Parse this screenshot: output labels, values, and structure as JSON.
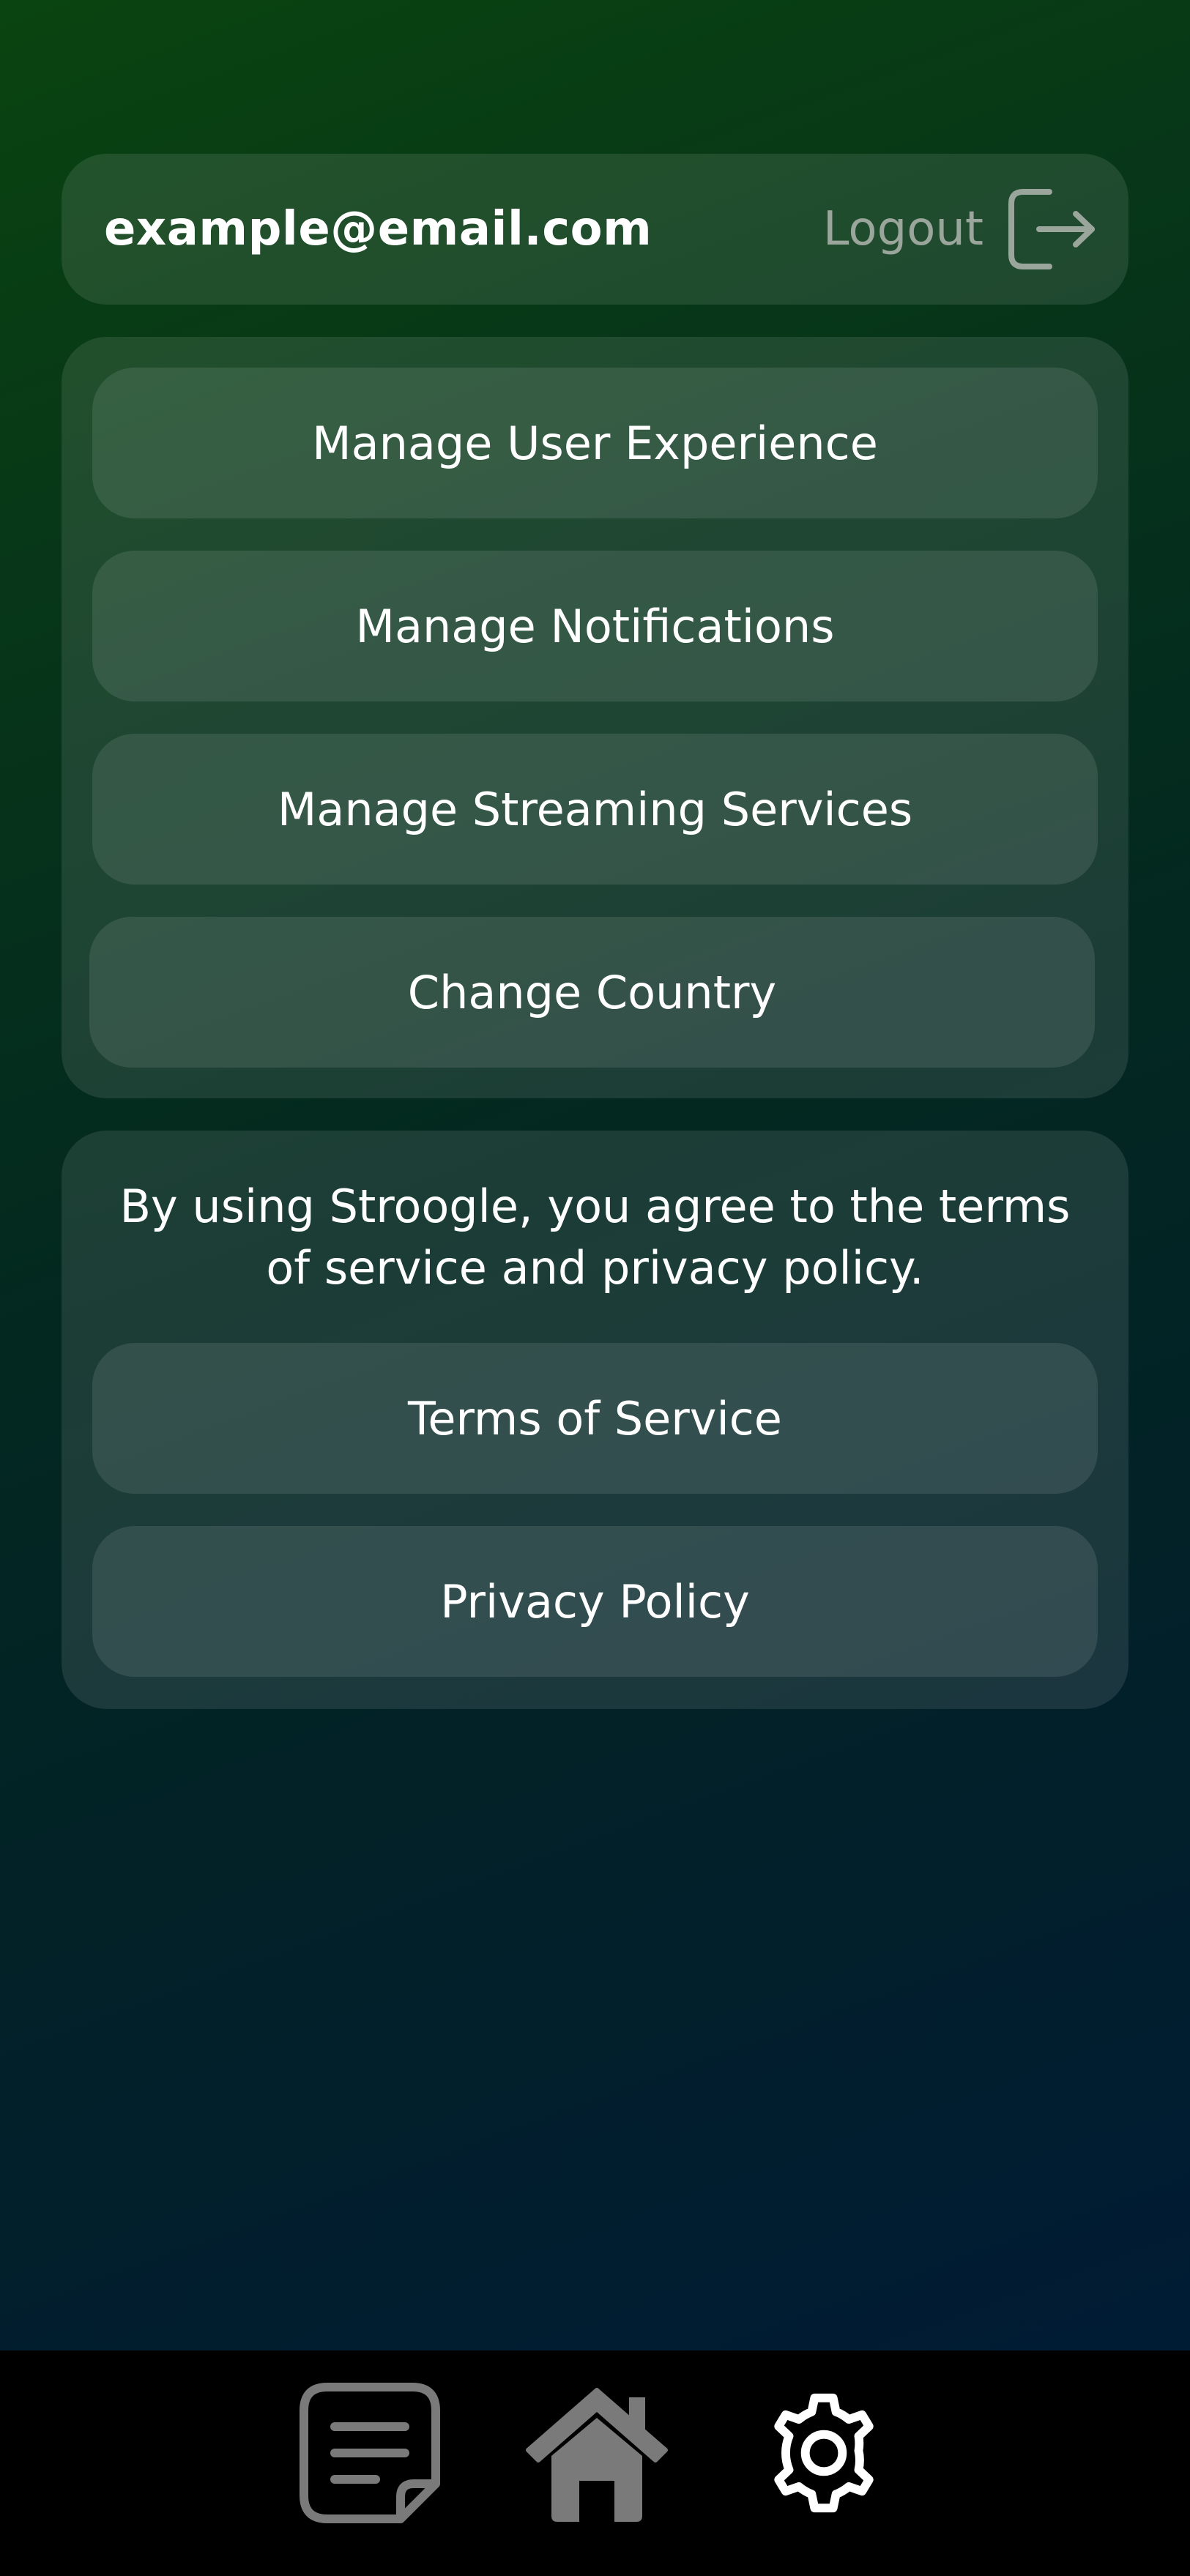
{
  "account": {
    "email": "example@email.com",
    "logout_label": "Logout",
    "logout_icon": "logout-icon"
  },
  "settings": {
    "items": [
      {
        "label": "Manage User Experience"
      },
      {
        "label": "Manage Notifications"
      },
      {
        "label": "Manage Streaming Services"
      },
      {
        "label": "Change Country"
      }
    ]
  },
  "legal": {
    "notice": "By using Stroogle, you agree to the terms of service and privacy policy.",
    "terms_label": "Terms of Service",
    "privacy_label": "Privacy Policy"
  },
  "bottom_nav": {
    "items": [
      {
        "icon": "notes-icon",
        "active": false
      },
      {
        "icon": "home-icon",
        "active": false
      },
      {
        "icon": "gear-icon",
        "active": true
      }
    ]
  },
  "colors": {
    "background_top": "#0a4410",
    "background_bottom": "#001a38",
    "nav_bar": "#000000",
    "inactive_icon": "#7a7a7a",
    "active_icon": "#ffffff",
    "muted_text": "#9aa59b"
  }
}
